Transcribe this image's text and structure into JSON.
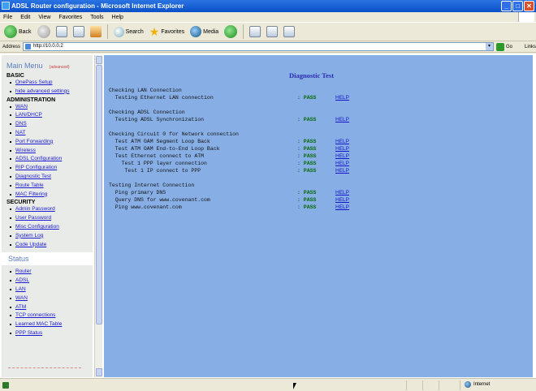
{
  "window": {
    "title": "ADSL Router configuration - Microsoft Internet Explorer",
    "controls": [
      "_",
      "□",
      "✕"
    ]
  },
  "menubar": [
    "File",
    "Edit",
    "View",
    "Favorites",
    "Tools",
    "Help"
  ],
  "toolbar": {
    "back_label": "Back",
    "search_label": "Search",
    "favorites_label": "Favorites",
    "media_label": "Media"
  },
  "address": {
    "label": "Address",
    "value": "http://10.0.0.2",
    "go_label": "Go",
    "links_label": "Links"
  },
  "sidebar": {
    "title": "Main Menu",
    "mode_link": "(advanced)",
    "sections": [
      {
        "heading": "BASIC",
        "items": [
          "OnePass Setup",
          "hide advanced settings"
        ]
      },
      {
        "heading": "ADMINISTRATION",
        "items": [
          "WAN",
          "LAN/DHCP",
          "DNS",
          "NAT",
          "Port Forwarding",
          "Wireless",
          "ADSL Configuration",
          "RIP Configuration",
          "Diagnostic Test",
          "Route Table",
          "MAC Filtering"
        ]
      },
      {
        "heading": "SECURITY",
        "items": [
          "Admin Password",
          "User Password",
          "Misc Configuration",
          "System Log",
          "Code Update"
        ]
      }
    ],
    "status_title": "Status",
    "status_items": [
      "Router",
      "ADSL",
      "LAN",
      "WAN",
      "ATM",
      "TCP connections",
      "Learned MAC Table",
      "PPP Status"
    ]
  },
  "main": {
    "title": "Diagnostic Test",
    "groups": [
      {
        "heading": "Checking LAN Connection",
        "tests": [
          {
            "label": "  Testing Ethernet LAN connection",
            "result": ": PASS",
            "help": "HELP"
          }
        ]
      },
      {
        "heading": "Checking ADSL Connection",
        "tests": [
          {
            "label": "  Testing ADSL Synchronization",
            "result": ": PASS",
            "help": "HELP"
          }
        ]
      },
      {
        "heading": "Checking Circuit 0 for Network connection",
        "tests": [
          {
            "label": "  Test ATM OAM Segment Loop Back",
            "result": ": PASS",
            "help": "HELP"
          },
          {
            "label": "  Test ATM OAM End-to-End Loop Back",
            "result": ": PASS",
            "help": "HELP"
          },
          {
            "label": "  Test Ethernet connect to ATM",
            "result": ": PASS",
            "help": "HELP"
          },
          {
            "label": "    Test 1 PPP layer connection",
            "result": ": PASS",
            "help": "HELP"
          },
          {
            "label": "     Test 1 IP connect to PPP",
            "result": ": PASS",
            "help": "HELP"
          }
        ]
      },
      {
        "heading": "Testing Internet Connection",
        "tests": [
          {
            "label": "  Ping primary DNS",
            "result": ": PASS",
            "help": "HELP"
          },
          {
            "label": "  Query DNS for www.covenant.com",
            "result": ": PASS",
            "help": "HELP"
          },
          {
            "label": "  Ping www.covenant.com",
            "result": ": PASS",
            "help": "HELP"
          }
        ]
      }
    ]
  },
  "statusbar": {
    "zone": "Internet"
  }
}
